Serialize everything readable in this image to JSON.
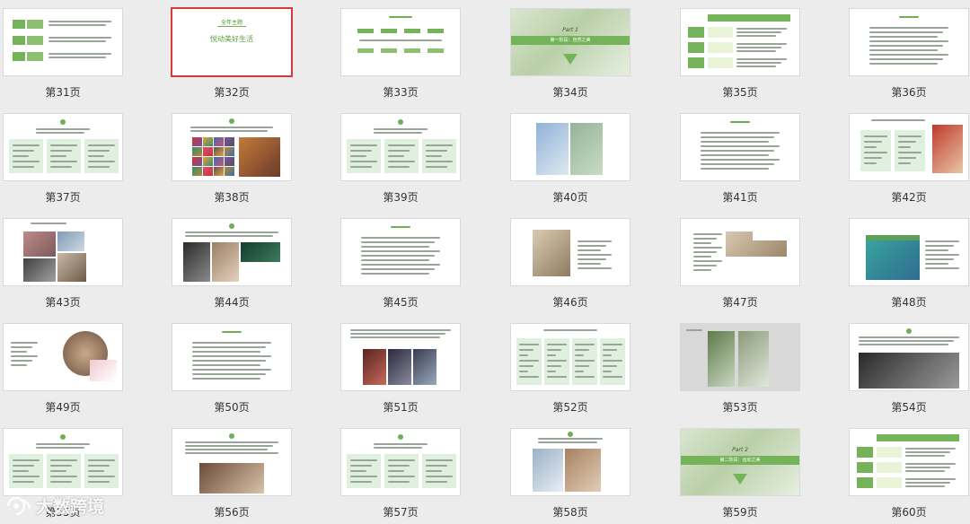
{
  "pages": [
    {
      "label": "第31页",
      "selected": false,
      "kind": "table"
    },
    {
      "label": "第32页",
      "selected": true,
      "kind": "title",
      "title": "全年主题",
      "subtitle": "悦动美好生活"
    },
    {
      "label": "第33页",
      "selected": false,
      "kind": "flow"
    },
    {
      "label": "第34页",
      "selected": false,
      "kind": "part",
      "part": "Part 1",
      "part_title": "第一阶段：自然之美"
    },
    {
      "label": "第35页",
      "selected": false,
      "kind": "table2"
    },
    {
      "label": "第36页",
      "selected": false,
      "kind": "text"
    },
    {
      "label": "第37页",
      "selected": false,
      "kind": "cols3"
    },
    {
      "label": "第38页",
      "selected": false,
      "kind": "photos"
    },
    {
      "label": "第39页",
      "selected": false,
      "kind": "cols3"
    },
    {
      "label": "第40页",
      "selected": false,
      "kind": "photos2"
    },
    {
      "label": "第41页",
      "selected": false,
      "kind": "text"
    },
    {
      "label": "第42页",
      "selected": false,
      "kind": "cols2photo"
    },
    {
      "label": "第43页",
      "selected": false,
      "kind": "collage"
    },
    {
      "label": "第44页",
      "selected": false,
      "kind": "photorow"
    },
    {
      "label": "第45页",
      "selected": false,
      "kind": "text"
    },
    {
      "label": "第46页",
      "selected": false,
      "kind": "photoleft"
    },
    {
      "label": "第47页",
      "selected": false,
      "kind": "textphoto"
    },
    {
      "label": "第48页",
      "selected": false,
      "kind": "photoright"
    },
    {
      "label": "第49页",
      "selected": false,
      "kind": "circlephoto"
    },
    {
      "label": "第50页",
      "selected": false,
      "kind": "text"
    },
    {
      "label": "第51页",
      "selected": false,
      "kind": "photorow3"
    },
    {
      "label": "第52页",
      "selected": false,
      "kind": "cols4"
    },
    {
      "label": "第53页",
      "selected": false,
      "kind": "grayphotos"
    },
    {
      "label": "第54页",
      "selected": false,
      "kind": "people"
    },
    {
      "label": "第55页",
      "selected": false,
      "kind": "cols3"
    },
    {
      "label": "第56页",
      "selected": false,
      "kind": "photowide"
    },
    {
      "label": "第57页",
      "selected": false,
      "kind": "cols3"
    },
    {
      "label": "第58页",
      "selected": false,
      "kind": "photoleft2"
    },
    {
      "label": "第59页",
      "selected": false,
      "kind": "part",
      "part": "Part 2",
      "part_title": "第二阶段：运动之美"
    },
    {
      "label": "第60页",
      "selected": false,
      "kind": "table2"
    }
  ],
  "watermark": "大数跨境"
}
